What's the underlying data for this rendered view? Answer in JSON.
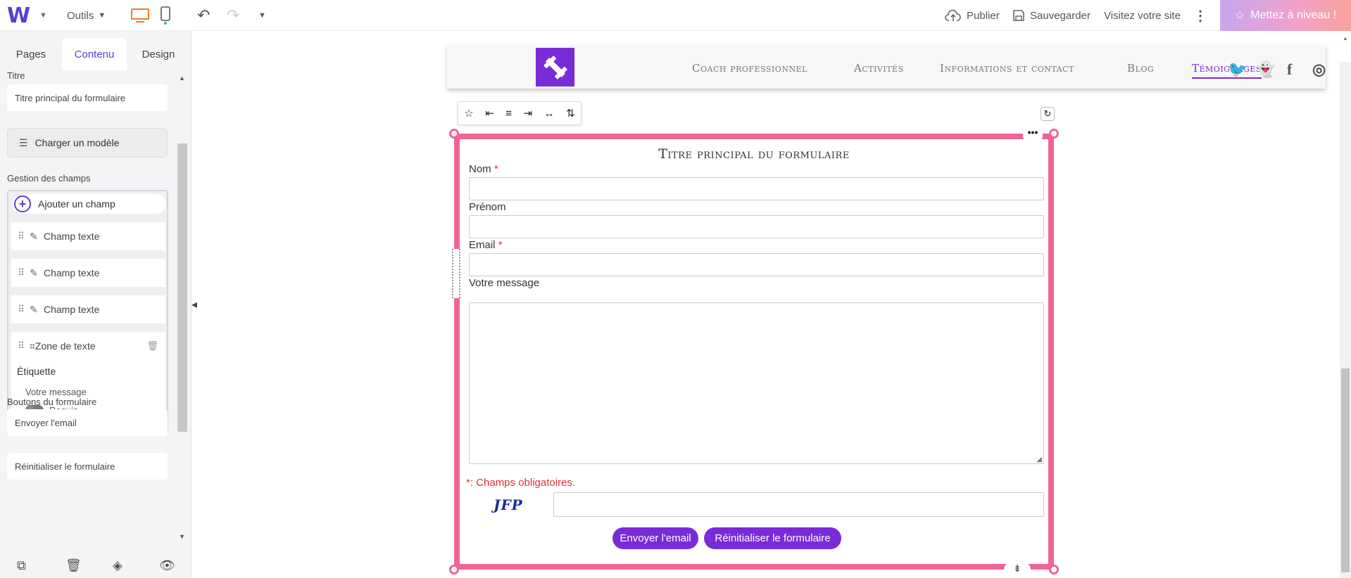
{
  "topbar": {
    "logo": "W",
    "tools_label": "Outils",
    "publish_label": "Publier",
    "save_label": "Sauvegarder",
    "visit_label": "Visitez votre site",
    "upgrade_label": "Mettez à niveau !",
    "accent_color": "#5a3fd4"
  },
  "panel": {
    "tabs": [
      {
        "label": "Pages"
      },
      {
        "label": "Contenu"
      },
      {
        "label": "Design"
      }
    ],
    "active_tab": "Contenu",
    "title_label": "Titre",
    "title_value": "Titre principal du formulaire",
    "load_model_label": "Charger un modèle",
    "fields_section_label": "Gestion des champs",
    "add_field_label": "Ajouter un champ",
    "fields": [
      {
        "type_label": "Champ texte"
      },
      {
        "type_label": "Champ texte"
      },
      {
        "type_label": "Champ texte"
      }
    ],
    "expanded_field": {
      "type_label": "Zone de texte",
      "label_heading": "Étiquette",
      "label_value": "Votre message",
      "required_label": "Requis",
      "required": false
    },
    "buttons_section_label": "Boutons du formulaire",
    "send_button_value": "Envoyer l'email",
    "reset_button_value": "Réinitialiser le formulaire"
  },
  "site": {
    "nav": [
      {
        "label": "Coach professionnel",
        "active": false
      },
      {
        "label": "Activités",
        "active": false
      },
      {
        "label": "Informations et contact",
        "active": false
      },
      {
        "label": "Blog",
        "active": false
      },
      {
        "label": "Témoignages",
        "active": true
      }
    ],
    "brand_color": "#7a2bd8",
    "socials": [
      "twitter-icon",
      "snapchat-icon",
      "facebook-icon",
      "instagram-icon"
    ]
  },
  "form": {
    "title": "Titre principal du formulaire",
    "fields": [
      {
        "label": "Nom",
        "required": true
      },
      {
        "label": "Prénom",
        "required": false
      },
      {
        "label": "Email",
        "required": true
      },
      {
        "label": "Votre message",
        "required": false
      }
    ],
    "required_star": "*",
    "required_note": "*: Champs obligatoires.",
    "captcha_text": "JFP",
    "send_label": "Envoyer l'email",
    "reset_label": "Réinitialiser le formulaire",
    "selection_color": "#f06590"
  }
}
